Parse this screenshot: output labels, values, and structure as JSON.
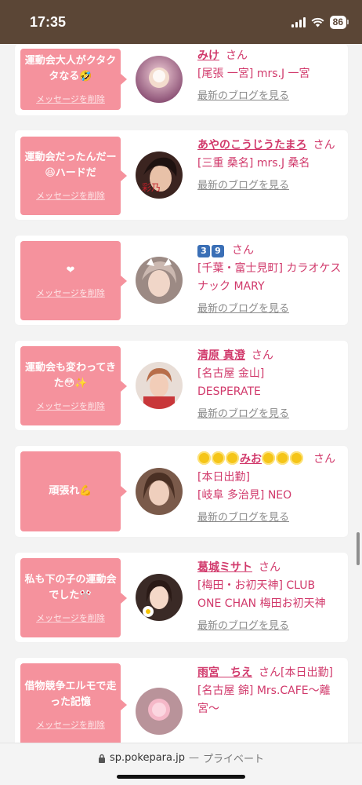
{
  "status": {
    "time": "17:35",
    "battery": "86"
  },
  "url_bar": {
    "domain": "sp.pokepara.jp",
    "separator": "—",
    "mode": "プライベート"
  },
  "delete_label": "メッセージを削除",
  "blog_label": "最新のブログを見る",
  "san_label": "さん",
  "cards": [
    {
      "message": "運動会大人がクタクタなる🤣",
      "name": "みけ",
      "shop": "[尾張 一宮] mrs.J 一宮",
      "avatar_color": "#c98fb0"
    },
    {
      "message": "運動会だったんだー😆ハードだ",
      "name": "あやのこうじうたまろ",
      "shop": "[三重 桑名] mrs.J 桑名",
      "avatar_color": "#6b3a2f"
    },
    {
      "message": "❤",
      "name": "3️⃣9️⃣",
      "shop": "[千葉・富士見町] カラオケスナック MARY",
      "avatar_color": "#b8a39a"
    },
    {
      "message": "運動会も変わってきた😳✨",
      "name": "清原 真澄",
      "shop": "[名古屋 金山] DESPERATE",
      "avatar_color": "#d9a08c"
    },
    {
      "message": "頑張れ💪",
      "name": "🌟🌟🌟みお🌟🌟🌟",
      "shop": "[岐阜 多治見] NEO",
      "prefix": "[本日出勤]",
      "avatar_color": "#8b6a55"
    },
    {
      "message": "私も下の子の運動会でした🎌",
      "name": "葛城ミサト",
      "shop": "[梅田・お初天神] CLUB ONE CHAN 梅田お初天神",
      "avatar_color": "#5a4038"
    },
    {
      "message": "借物競争エルモで走った記憶",
      "name": "雨宮　ちえ",
      "shop": "[名古屋 錦] Mrs.CAFE〜離宮〜",
      "prefix": "[本日出勤]",
      "avatar_color": "#c58c95"
    }
  ]
}
